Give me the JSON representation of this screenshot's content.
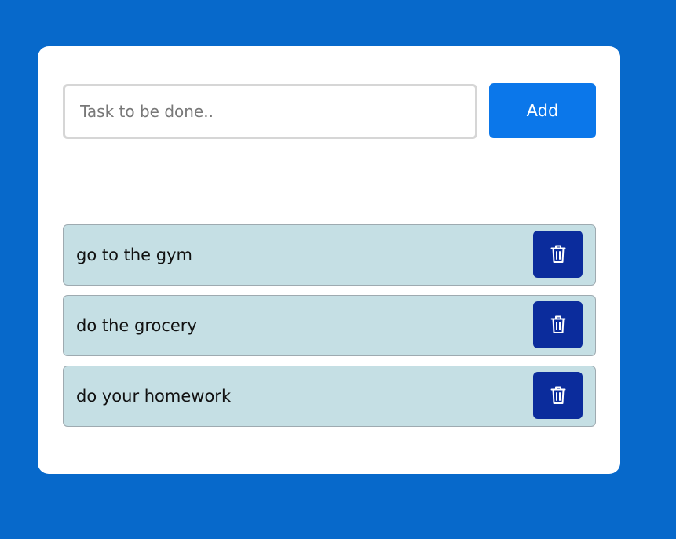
{
  "form": {
    "input_value": "",
    "input_placeholder": "Task to be done..",
    "add_label": "Add"
  },
  "todos": [
    {
      "text": "go to the gym",
      "delete_icon": "trash-icon"
    },
    {
      "text": "do the grocery",
      "delete_icon": "trash-icon"
    },
    {
      "text": "do your homework",
      "delete_icon": "trash-icon"
    }
  ],
  "colors": {
    "page_background": "#0769cb",
    "card_background": "#ffffff",
    "add_button": "#0b77ea",
    "todo_item_background": "#c5dfe4",
    "delete_button": "#0b2c9c"
  }
}
